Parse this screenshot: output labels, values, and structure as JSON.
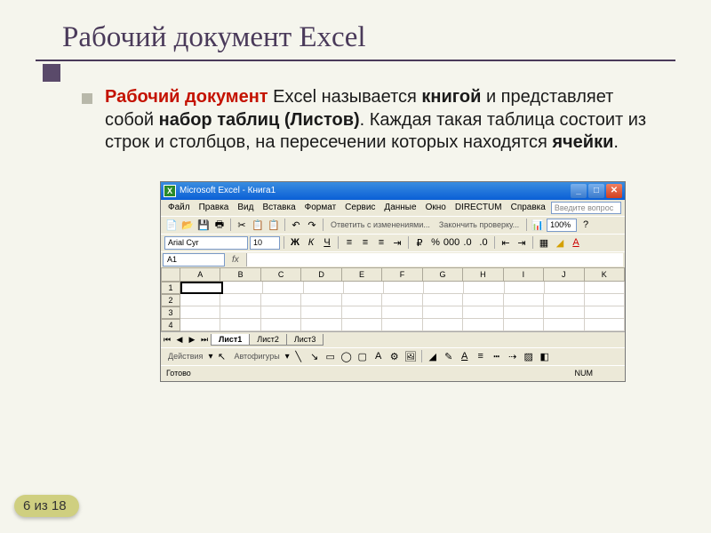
{
  "title": "Рабочий документ Excel",
  "para": {
    "p1_red": "Рабочий документ",
    "p2": " Excel называется ",
    "p3_bold": "книгой",
    "p4": " и представляет собой ",
    "p5_bold": "набор таблиц (Листов)",
    "p6": ". Каждая такая таблица состоит из строк и столбцов, на пересечении которых находятся ",
    "p7_bold": "ячейки",
    "p8": "."
  },
  "excel": {
    "app_title": "Microsoft Excel - Книга1",
    "menu": [
      "Файл",
      "Правка",
      "Вид",
      "Вставка",
      "Формат",
      "Сервис",
      "Данные",
      "Окно",
      "DIRECTUM",
      "Справка"
    ],
    "ask": "Введите вопрос",
    "toolbar_text1": "Ответить с изменениями...",
    "toolbar_text2": "Закончить проверку...",
    "zoom": "100%",
    "font": "Arial Cyr",
    "size": "10",
    "namebox": "A1",
    "cols": [
      "A",
      "B",
      "C",
      "D",
      "E",
      "F",
      "G",
      "H",
      "I",
      "J",
      "K"
    ],
    "rows": [
      "1",
      "2",
      "3",
      "4"
    ],
    "tabs": [
      "Лист1",
      "Лист2",
      "Лист3"
    ],
    "draw": "Действия",
    "autoshapes": "Автофигуры",
    "status": "Готово",
    "num": "NUM"
  },
  "pagenum": "6 из 18"
}
